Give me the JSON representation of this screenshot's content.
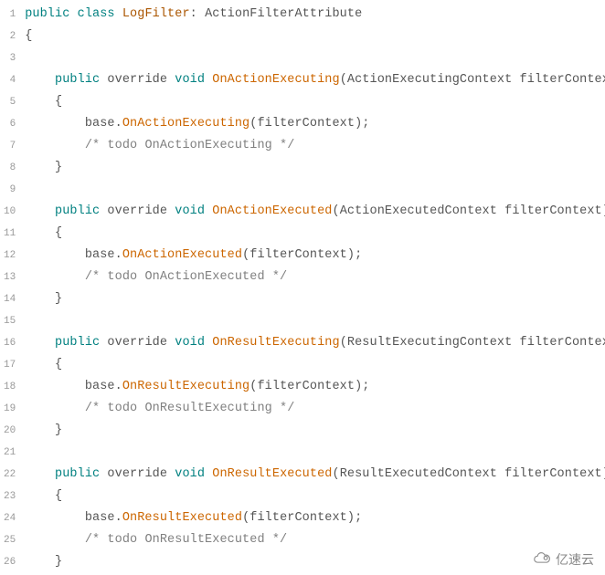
{
  "lines": [
    {
      "n": "1",
      "tokens": [
        {
          "c": "keyword",
          "t": "public"
        },
        {
          "c": "text",
          "t": " "
        },
        {
          "c": "keyword",
          "t": "class"
        },
        {
          "c": "text",
          "t": " "
        },
        {
          "c": "type",
          "t": "LogFilter"
        },
        {
          "c": "punct",
          "t": ": "
        },
        {
          "c": "text",
          "t": "ActionFilterAttribute"
        }
      ]
    },
    {
      "n": "2",
      "tokens": [
        {
          "c": "punct",
          "t": "{"
        }
      ]
    },
    {
      "n": "3",
      "tokens": []
    },
    {
      "n": "4",
      "tokens": [
        {
          "c": "text",
          "t": "    "
        },
        {
          "c": "keyword",
          "t": "public"
        },
        {
          "c": "text",
          "t": " override "
        },
        {
          "c": "keyword",
          "t": "void"
        },
        {
          "c": "text",
          "t": " "
        },
        {
          "c": "method",
          "t": "OnActionExecuting"
        },
        {
          "c": "punct",
          "t": "("
        },
        {
          "c": "text",
          "t": "ActionExecutingContext filterContext"
        },
        {
          "c": "punct",
          "t": ")"
        }
      ]
    },
    {
      "n": "5",
      "tokens": [
        {
          "c": "text",
          "t": "    "
        },
        {
          "c": "punct",
          "t": "{"
        }
      ]
    },
    {
      "n": "6",
      "tokens": [
        {
          "c": "text",
          "t": "        base"
        },
        {
          "c": "punct",
          "t": "."
        },
        {
          "c": "method",
          "t": "OnActionExecuting"
        },
        {
          "c": "punct",
          "t": "("
        },
        {
          "c": "text",
          "t": "filterContext"
        },
        {
          "c": "punct",
          "t": ");"
        }
      ]
    },
    {
      "n": "7",
      "tokens": [
        {
          "c": "text",
          "t": "        "
        },
        {
          "c": "comment",
          "t": "/* todo OnActionExecuting */"
        }
      ]
    },
    {
      "n": "8",
      "tokens": [
        {
          "c": "text",
          "t": "    "
        },
        {
          "c": "punct",
          "t": "}"
        }
      ]
    },
    {
      "n": "9",
      "tokens": []
    },
    {
      "n": "10",
      "tokens": [
        {
          "c": "text",
          "t": "    "
        },
        {
          "c": "keyword",
          "t": "public"
        },
        {
          "c": "text",
          "t": " override "
        },
        {
          "c": "keyword",
          "t": "void"
        },
        {
          "c": "text",
          "t": " "
        },
        {
          "c": "method",
          "t": "OnActionExecuted"
        },
        {
          "c": "punct",
          "t": "("
        },
        {
          "c": "text",
          "t": "ActionExecutedContext filterContext"
        },
        {
          "c": "punct",
          "t": ")"
        }
      ]
    },
    {
      "n": "11",
      "tokens": [
        {
          "c": "text",
          "t": "    "
        },
        {
          "c": "punct",
          "t": "{"
        }
      ]
    },
    {
      "n": "12",
      "tokens": [
        {
          "c": "text",
          "t": "        base"
        },
        {
          "c": "punct",
          "t": "."
        },
        {
          "c": "method",
          "t": "OnActionExecuted"
        },
        {
          "c": "punct",
          "t": "("
        },
        {
          "c": "text",
          "t": "filterContext"
        },
        {
          "c": "punct",
          "t": ");"
        }
      ]
    },
    {
      "n": "13",
      "tokens": [
        {
          "c": "text",
          "t": "        "
        },
        {
          "c": "comment",
          "t": "/* todo OnActionExecuted */"
        }
      ]
    },
    {
      "n": "14",
      "tokens": [
        {
          "c": "text",
          "t": "    "
        },
        {
          "c": "punct",
          "t": "}"
        }
      ]
    },
    {
      "n": "15",
      "tokens": []
    },
    {
      "n": "16",
      "tokens": [
        {
          "c": "text",
          "t": "    "
        },
        {
          "c": "keyword",
          "t": "public"
        },
        {
          "c": "text",
          "t": " override "
        },
        {
          "c": "keyword",
          "t": "void"
        },
        {
          "c": "text",
          "t": " "
        },
        {
          "c": "method",
          "t": "OnResultExecuting"
        },
        {
          "c": "punct",
          "t": "("
        },
        {
          "c": "text",
          "t": "ResultExecutingContext filterContext"
        },
        {
          "c": "punct",
          "t": ")"
        }
      ]
    },
    {
      "n": "17",
      "tokens": [
        {
          "c": "text",
          "t": "    "
        },
        {
          "c": "punct",
          "t": "{"
        }
      ]
    },
    {
      "n": "18",
      "tokens": [
        {
          "c": "text",
          "t": "        base"
        },
        {
          "c": "punct",
          "t": "."
        },
        {
          "c": "method",
          "t": "OnResultExecuting"
        },
        {
          "c": "punct",
          "t": "("
        },
        {
          "c": "text",
          "t": "filterContext"
        },
        {
          "c": "punct",
          "t": ");"
        }
      ]
    },
    {
      "n": "19",
      "tokens": [
        {
          "c": "text",
          "t": "        "
        },
        {
          "c": "comment",
          "t": "/* todo OnResultExecuting */"
        }
      ]
    },
    {
      "n": "20",
      "tokens": [
        {
          "c": "text",
          "t": "    "
        },
        {
          "c": "punct",
          "t": "}"
        }
      ]
    },
    {
      "n": "21",
      "tokens": []
    },
    {
      "n": "22",
      "tokens": [
        {
          "c": "text",
          "t": "    "
        },
        {
          "c": "keyword",
          "t": "public"
        },
        {
          "c": "text",
          "t": " override "
        },
        {
          "c": "keyword",
          "t": "void"
        },
        {
          "c": "text",
          "t": " "
        },
        {
          "c": "method",
          "t": "OnResultExecuted"
        },
        {
          "c": "punct",
          "t": "("
        },
        {
          "c": "text",
          "t": "ResultExecutedContext filterContext"
        },
        {
          "c": "punct",
          "t": ")"
        }
      ]
    },
    {
      "n": "23",
      "tokens": [
        {
          "c": "text",
          "t": "    "
        },
        {
          "c": "punct",
          "t": "{"
        }
      ]
    },
    {
      "n": "24",
      "tokens": [
        {
          "c": "text",
          "t": "        base"
        },
        {
          "c": "punct",
          "t": "."
        },
        {
          "c": "method",
          "t": "OnResultExecuted"
        },
        {
          "c": "punct",
          "t": "("
        },
        {
          "c": "text",
          "t": "filterContext"
        },
        {
          "c": "punct",
          "t": ");"
        }
      ]
    },
    {
      "n": "25",
      "tokens": [
        {
          "c": "text",
          "t": "        "
        },
        {
          "c": "comment",
          "t": "/* todo OnResultExecuted */"
        }
      ]
    },
    {
      "n": "26",
      "tokens": [
        {
          "c": "text",
          "t": "    "
        },
        {
          "c": "punct",
          "t": "}"
        }
      ]
    }
  ],
  "watermark": {
    "text": "亿速云"
  }
}
